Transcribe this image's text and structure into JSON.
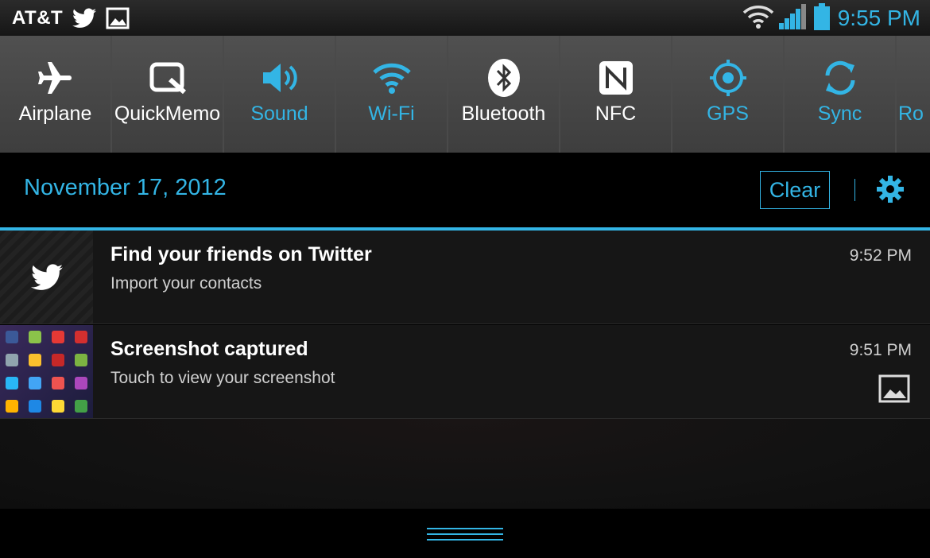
{
  "status_bar": {
    "carrier": "AT&T",
    "time": "9:55 PM",
    "left_icons": [
      "twitter-icon",
      "picture-icon"
    ],
    "right_icons": [
      "wifi-icon",
      "signal-icon",
      "battery-icon"
    ],
    "accent_color": "#33b5e5"
  },
  "quick_settings": [
    {
      "label": "Airplane",
      "icon": "airplane-icon",
      "active": false
    },
    {
      "label": "QuickMemo",
      "icon": "quickmemo-icon",
      "active": false
    },
    {
      "label": "Sound",
      "icon": "speaker-icon",
      "active": true
    },
    {
      "label": "Wi-Fi",
      "icon": "wifi-icon",
      "active": true
    },
    {
      "label": "Bluetooth",
      "icon": "bluetooth-icon",
      "active": false
    },
    {
      "label": "NFC",
      "icon": "nfc-icon",
      "active": false
    },
    {
      "label": "GPS",
      "icon": "gps-icon",
      "active": true
    },
    {
      "label": "Sync",
      "icon": "sync-icon",
      "active": true
    },
    {
      "label": "Ro",
      "icon": "rotation-icon",
      "active": true
    }
  ],
  "header": {
    "date": "November 17, 2012",
    "clear_label": "Clear"
  },
  "notifications": [
    {
      "title": "Find your friends on Twitter",
      "subtitle": "Import your contacts",
      "time": "9:52 PM",
      "icon": "twitter-icon"
    },
    {
      "title": "Screenshot captured",
      "subtitle": "Touch to view your screenshot",
      "time": "9:51 PM",
      "icon": "screenshot-thumbnail"
    }
  ]
}
